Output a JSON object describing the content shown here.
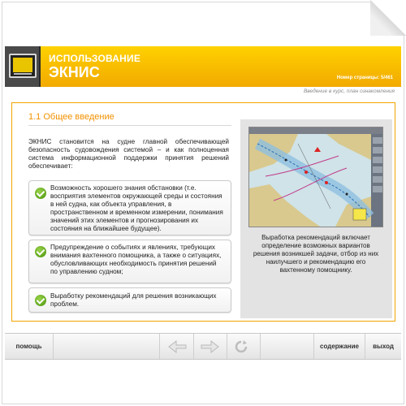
{
  "header": {
    "title_line1": "ИСПОЛЬЗОВАНИЕ",
    "title_line2": "ЭКНИС",
    "page_counter": "Номер страницы: 5/461"
  },
  "breadcrumb": "Введение в курс, план ознакомления",
  "content": {
    "section_title": "1.1 Общее введение",
    "intro": "ЭКНИС становится на судне главной обеспечивающей безопасность судовождения системой – и как полноценная система информационной поддержки принятия решений обеспечивает:",
    "bullets": [
      "Возможность хорошего знания обстановки (т.е. восприятия элементов окружающей среды и состояния в ней судна, как объекта управления, в пространственном и временном измерении, понимания значений этих элементов и прогнозирования их состояния на ближайшее будущее).",
      "Предупреждение о событиях и явлениях, требующих внимания вахтенного помощника, а также о ситуациях, обусловливающих необходимость принятия решений по управлению судном;",
      "Выработку рекомендаций для решения возникающих проблем."
    ],
    "caption": "Выработка рекомендаций включает определение возможных вариантов решения возникшей задачи, отбор из них наилучшего и рекомендацию его вахтенному помощнику."
  },
  "toolbar": {
    "help": "помощь",
    "contents": "содержание",
    "exit": "выход"
  },
  "icons": {
    "header": "monitor-icon",
    "check": "checkmark-icon",
    "back": "arrow-left-icon",
    "forward": "arrow-right-icon",
    "replay": "replay-icon"
  },
  "colors": {
    "accent": "#f2a400",
    "section_title": "#f29100",
    "check_green": "#5fa51c"
  }
}
